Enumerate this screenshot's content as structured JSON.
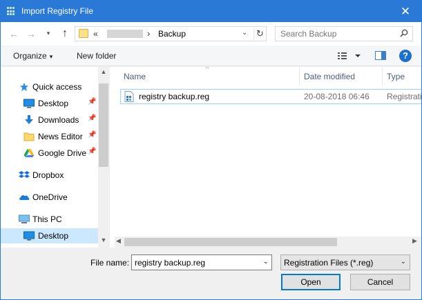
{
  "window": {
    "title": "Import Registry File",
    "close_glyph": "✕"
  },
  "nav": {
    "back_glyph": "←",
    "forward_glyph": "→",
    "recent_glyph": "▾",
    "up_glyph": "↑"
  },
  "address": {
    "overflow": "«",
    "separator": "›",
    "crumb": "Backup",
    "dropdown_glyph": "⌄",
    "refresh_glyph": "↻"
  },
  "search": {
    "placeholder": "Search Backup"
  },
  "toolbar": {
    "organize_label": "Organize",
    "organize_caret": "▾",
    "new_folder_label": "New folder",
    "help_label": "?"
  },
  "sidebar": {
    "pin_glyph": "📌",
    "items": [
      {
        "label": "Quick access",
        "icon": "star-icon"
      },
      {
        "label": "Desktop",
        "icon": "desktop-icon",
        "pinned": true
      },
      {
        "label": "Downloads",
        "icon": "download-icon",
        "pinned": true
      },
      {
        "label": "News Editor",
        "icon": "folder-icon",
        "pinned": true
      },
      {
        "label": "Google Drive",
        "icon": "google-drive-icon",
        "pinned": true
      },
      {
        "label": "Dropbox",
        "icon": "dropbox-icon"
      },
      {
        "label": "OneDrive",
        "icon": "cloud-icon"
      },
      {
        "label": "This PC",
        "icon": "computer-icon"
      },
      {
        "label": "Desktop",
        "icon": "desktop-icon",
        "selected": true
      }
    ]
  },
  "filelist": {
    "columns": [
      "Name",
      "Date modified",
      "Type"
    ],
    "sort_glyph": "^",
    "rows": [
      {
        "name": "registry backup.reg",
        "date": "20-08-2018 06:46",
        "type": "Registration Entries"
      }
    ]
  },
  "scroll": {
    "up": "▲",
    "down": "▼",
    "left": "◀",
    "right": "▶"
  },
  "footer": {
    "file_name_label": "File name:",
    "file_name_value": "registry backup.reg",
    "file_type": "Registration Files (*.reg)",
    "dropdown_glyph": "⌄",
    "open_label": "Open",
    "cancel_label": "Cancel"
  },
  "colors": {
    "accent": "#2b79d6",
    "selection": "#cce8ff",
    "focus_border": "#0078d7"
  }
}
